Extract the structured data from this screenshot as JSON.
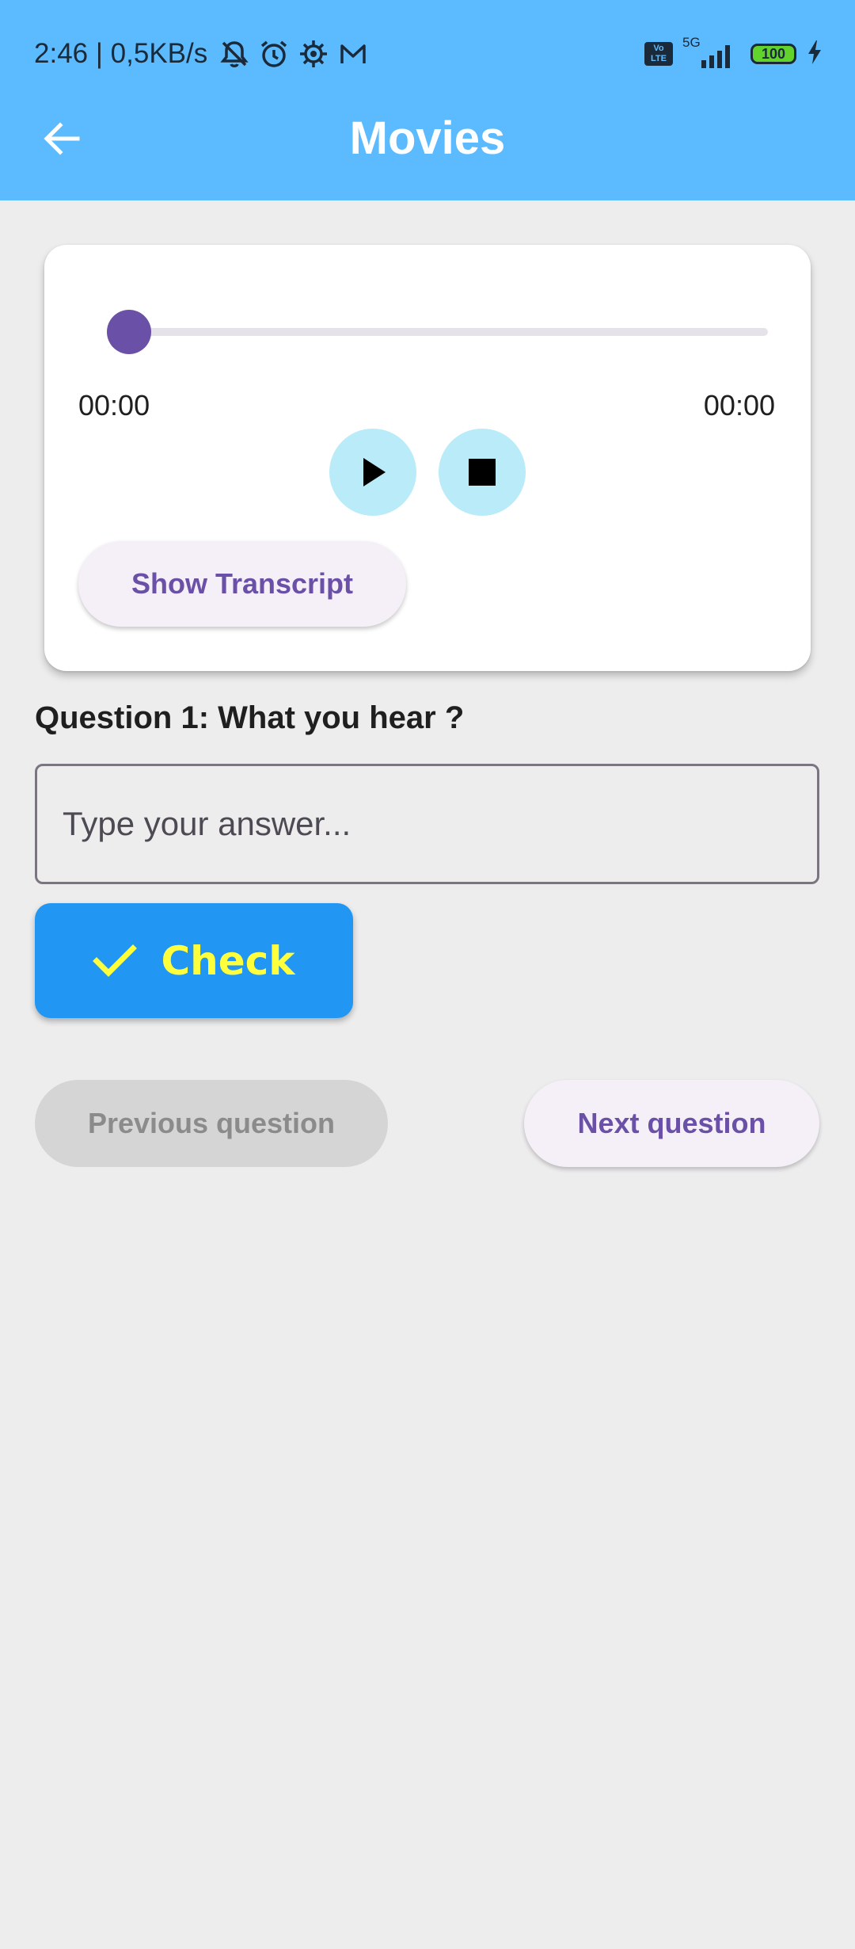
{
  "status_bar": {
    "time_speed": "2:46 | 0,5KB/s",
    "icons": [
      "muted-bell-icon",
      "alarm-clock-icon",
      "settings-gear-icon",
      "mail-icon"
    ],
    "volte": "Vo LTE",
    "network": "5G",
    "battery": "100"
  },
  "app_bar": {
    "title": "Movies",
    "back_icon": "arrow-left-icon"
  },
  "player": {
    "progress": 0,
    "current_time": "00:00",
    "total_time": "00:00",
    "play_icon": "play-icon",
    "stop_icon": "stop-icon",
    "transcript_button": "Show Transcript"
  },
  "question": {
    "text": "Question 1: What you hear ?",
    "answer_placeholder": "Type your answer...",
    "answer_value": ""
  },
  "check_button": {
    "label": "Check",
    "icon": "checkmark-icon"
  },
  "navigation": {
    "previous_label": "Previous question",
    "next_label": "Next question"
  },
  "colors": {
    "app_bar": "#5bbbfe",
    "accent_purple": "#6a50a7",
    "check_button": "#2196f3",
    "check_text": "#ffff3b",
    "round_button": "#b9ebf8",
    "background": "#eeedee"
  }
}
